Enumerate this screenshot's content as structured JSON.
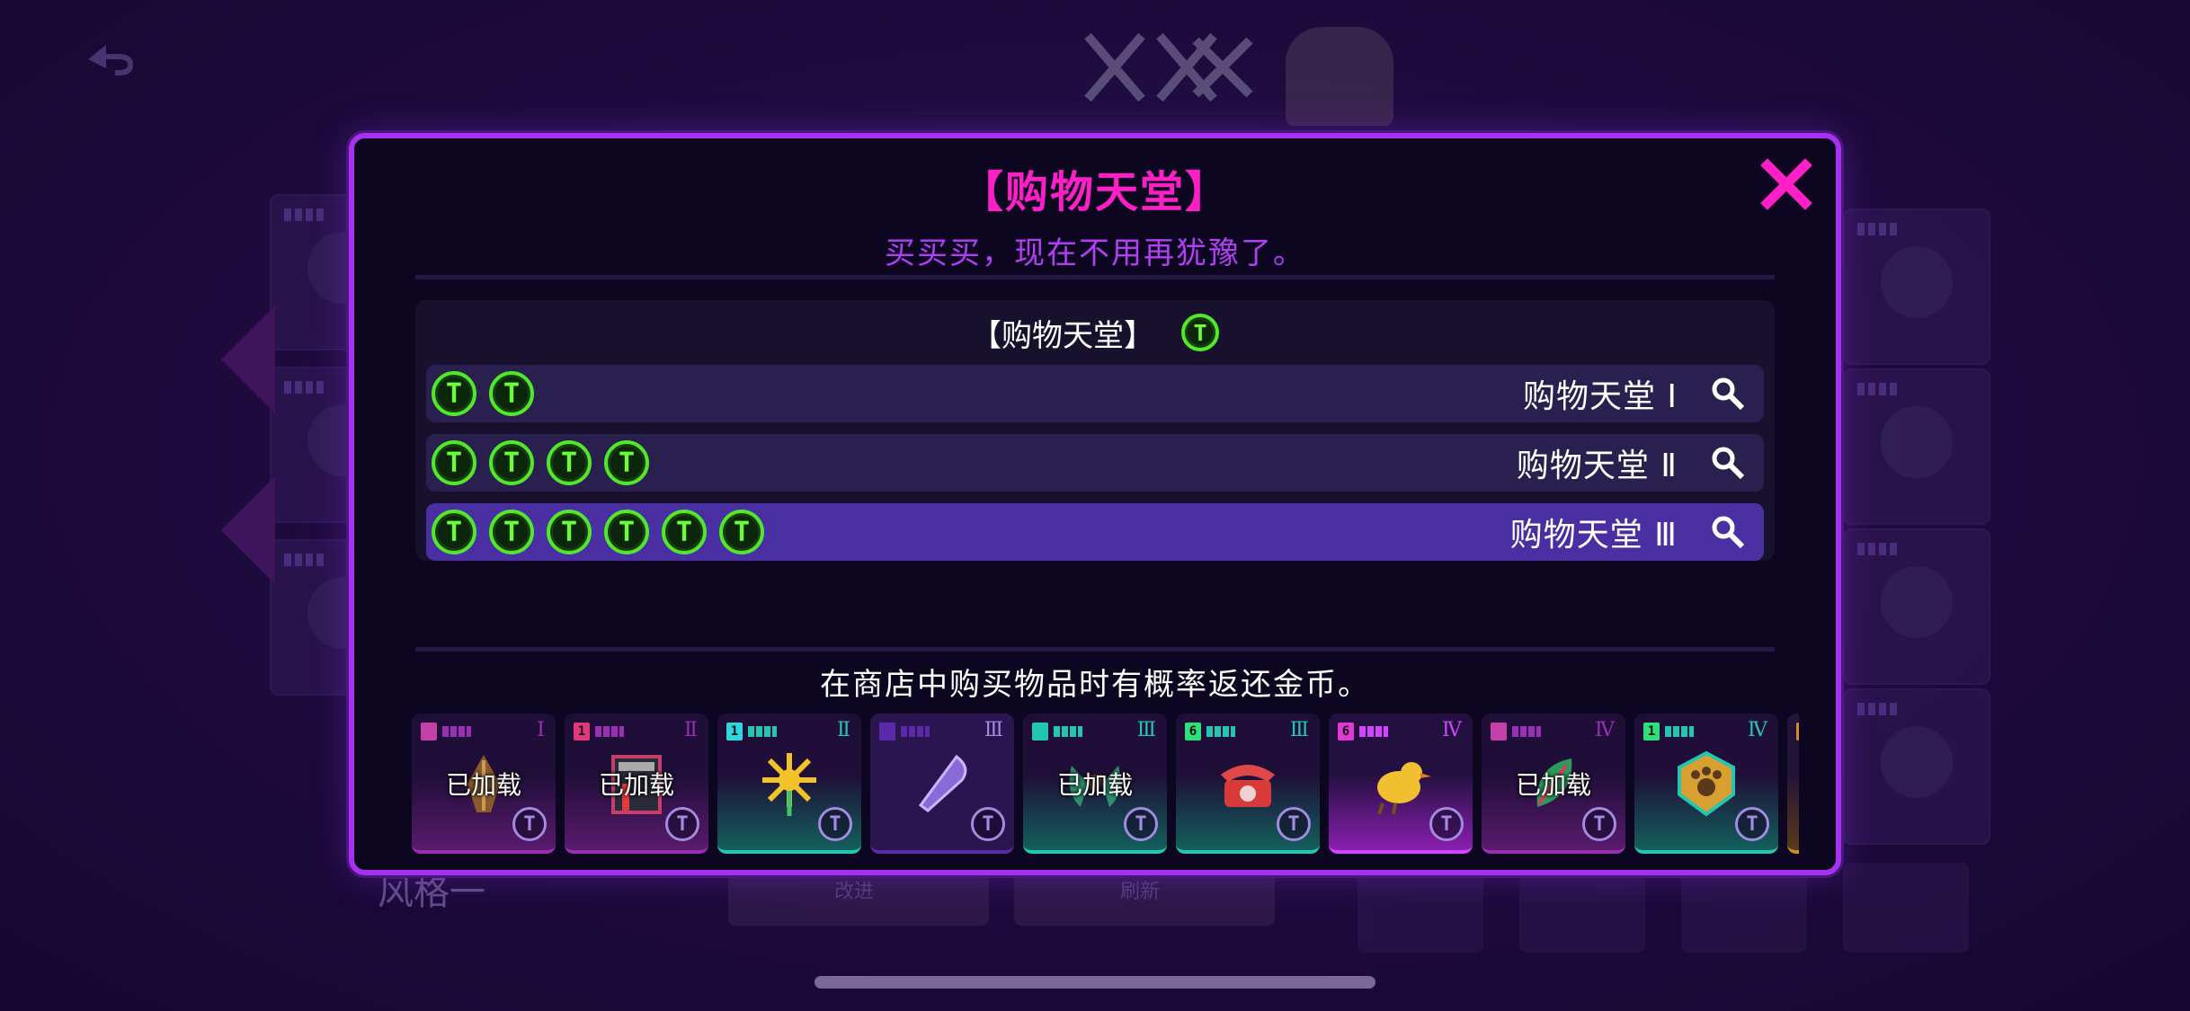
{
  "background": {
    "style_label": "风格一",
    "left_button_label": "改进",
    "right_button_label": "刷新"
  },
  "dialog": {
    "title": "【购物天堂】",
    "subtitle": "买买买，现在不用再犹豫了。",
    "set_header": "【购物天堂】",
    "tiers": [
      {
        "name": "购物天堂 Ⅰ",
        "coins": 2,
        "selected": false
      },
      {
        "name": "购物天堂 Ⅱ",
        "coins": 4,
        "selected": false
      },
      {
        "name": "购物天堂 Ⅲ",
        "coins": 6,
        "selected": true
      }
    ],
    "coin_letter": "T",
    "description": "在商店中购买物品时有概率返还金币。",
    "items": [
      {
        "rank": "Ⅰ",
        "tier": "",
        "equipped": "已加载",
        "style": "purple",
        "icon": "feather-icon",
        "dots": "#9a2fb3",
        "tag": "#c43fa8"
      },
      {
        "rank": "Ⅱ",
        "tier": "1",
        "equipped": "已加载",
        "style": "purple",
        "icon": "book-icon",
        "dots": "#9a2fb3",
        "tag": "#e0387a"
      },
      {
        "rank": "Ⅱ",
        "tier": "1",
        "equipped": "",
        "style": "teal",
        "icon": "sun-flower-icon",
        "dots": "#23c7b1",
        "tag": "#2fd6e0"
      },
      {
        "rank": "Ⅲ",
        "tier": "",
        "equipped": "",
        "style": "violet",
        "icon": "blade-icon",
        "dots": "#5c2aa8",
        "tag": "#5c2aa8"
      },
      {
        "rank": "Ⅲ",
        "tier": "",
        "equipped": "已加载",
        "style": "teal",
        "icon": "claw-icon",
        "dots": "#23c7b1",
        "tag": "#23c7b1"
      },
      {
        "rank": "Ⅲ",
        "tier": "6",
        "equipped": "",
        "style": "teal",
        "icon": "telephone-icon",
        "dots": "#23c7b1",
        "tag": "#2fe07a"
      },
      {
        "rank": "Ⅳ",
        "tier": "6",
        "equipped": "",
        "style": "magenta",
        "icon": "bird-icon",
        "dots": "#d145ff",
        "tag": "#e03ad6"
      },
      {
        "rank": "Ⅳ",
        "tier": "",
        "equipped": "已加载",
        "style": "purple",
        "icon": "leaf-icon",
        "dots": "#9a2fb3",
        "tag": "#c43fa8"
      },
      {
        "rank": "Ⅳ",
        "tier": "1",
        "equipped": "",
        "style": "teal",
        "icon": "paw-shield-icon",
        "dots": "#23c7b1",
        "tag": "#2fe07a"
      },
      {
        "rank": "",
        "tier": "",
        "equipped": "",
        "style": "gold",
        "icon": "partial-card-icon",
        "dots": "#d08a2a",
        "tag": "#d08a2a"
      }
    ]
  },
  "colors": {
    "frame": "#a632f0",
    "title": "#ff1fc6",
    "subtitle": "#b23ef5",
    "coin": "#52e82a",
    "selected_row": "#4a2fa2"
  }
}
